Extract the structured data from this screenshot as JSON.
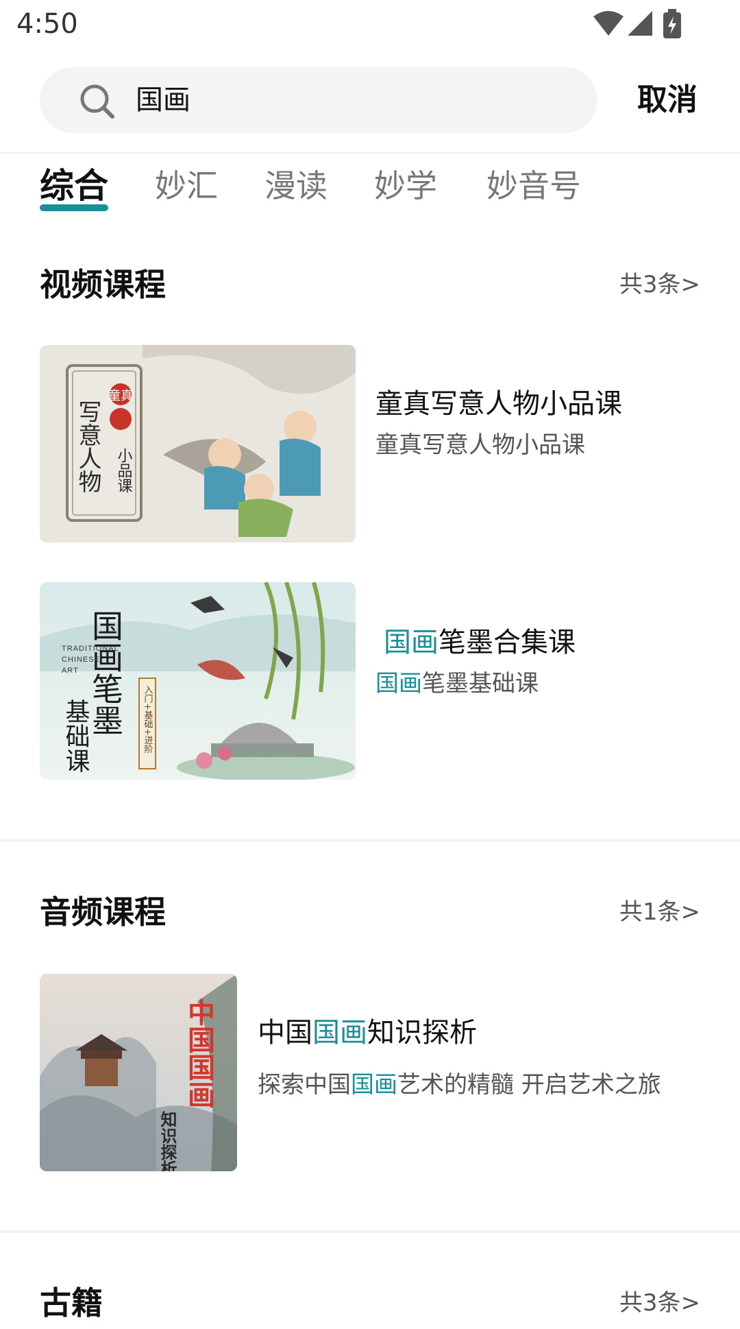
{
  "status": {
    "time": "4:50"
  },
  "search": {
    "query": "国画",
    "cancel": "取消"
  },
  "tabs": [
    {
      "label": "综合"
    },
    {
      "label": "妙汇"
    },
    {
      "label": "漫读"
    },
    {
      "label": "妙学"
    },
    {
      "label": "妙音号"
    }
  ],
  "video": {
    "title": "视频课程",
    "count": "共3条>",
    "items": [
      {
        "title": "童真写意人物小品课",
        "subtitle": "童真写意人物小品课",
        "thumb_text": [
          "写意人物",
          "小品课",
          "童真"
        ]
      },
      {
        "title_hl": "国画",
        "title_rest": "笔墨合集课",
        "sub_hl": "国画",
        "sub_rest": "笔墨基础课",
        "thumb_text": [
          "国画笔墨",
          "基础课",
          "TRADITIONAL",
          "CHINESE",
          "ART",
          "入门+基础+进阶"
        ]
      }
    ]
  },
  "audio": {
    "title": "音频课程",
    "count": "共1条>",
    "items": [
      {
        "title_pre": "中国",
        "title_hl": "国画",
        "title_post": "知识探析",
        "sub_pre": "探索中国",
        "sub_hl": "国画",
        "sub_post": "艺术的精髓 开启艺术之旅",
        "thumb_text": [
          "中国国画",
          "知识探析"
        ]
      }
    ]
  },
  "books": {
    "title": "古籍",
    "count": "共3条>"
  },
  "colors": {
    "accent": "#1a8f99"
  }
}
